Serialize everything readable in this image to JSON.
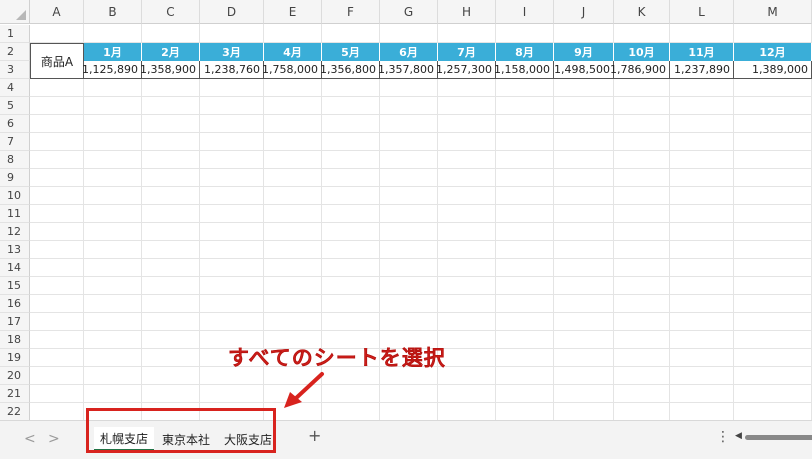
{
  "grid": {
    "columns": [
      "A",
      "B",
      "C",
      "D",
      "E",
      "F",
      "G",
      "H",
      "I",
      "J",
      "K",
      "L",
      "M"
    ],
    "rows": [
      "1",
      "2",
      "3",
      "4",
      "5",
      "6",
      "7",
      "8",
      "9",
      "10",
      "11",
      "12",
      "13",
      "14",
      "15",
      "16",
      "17",
      "18",
      "19",
      "20",
      "21",
      "22"
    ]
  },
  "table": {
    "product": "商品A",
    "months": [
      "1月",
      "2月",
      "3月",
      "4月",
      "5月",
      "6月",
      "7月",
      "8月",
      "9月",
      "10月",
      "11月",
      "12月"
    ],
    "values": [
      "1,125,890",
      "1,358,900",
      "1,238,760",
      "1,758,000",
      "1,356,800",
      "1,357,800",
      "1,257,300",
      "1,158,000",
      "1,498,500",
      "1,786,900",
      "1,237,890",
      "1,389,000"
    ]
  },
  "tabs": {
    "prev": "<",
    "next": ">",
    "sheets": [
      "札幌支店",
      "東京本社",
      "大阪支店"
    ],
    "active_index": 0,
    "add": "+",
    "more": "⋮"
  },
  "annotation": {
    "text": "すべてのシートを選択",
    "color": "#d8231e"
  },
  "colors": {
    "header_blue": "#3aaed8",
    "active_tab_underline": "#217346"
  }
}
